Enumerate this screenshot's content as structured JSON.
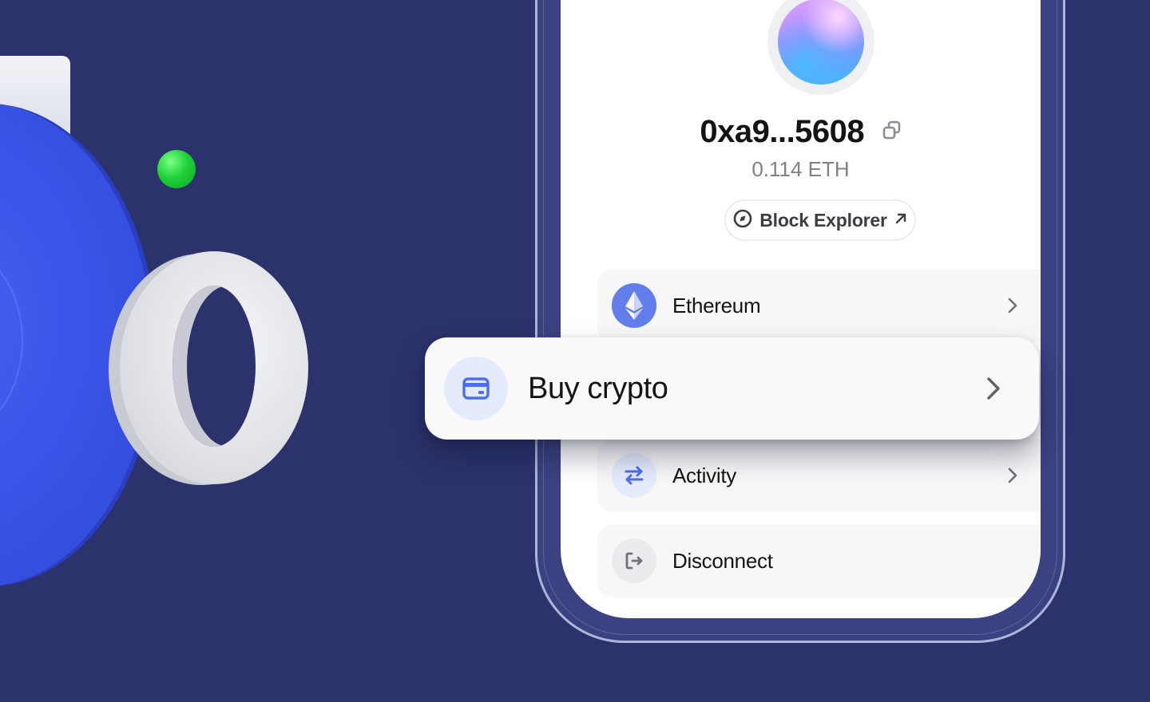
{
  "wallet": {
    "address": "0xa9...5608",
    "balance": "0.114 ETH",
    "copy_icon": "copy-icon",
    "avatar": "gradient-avatar"
  },
  "explorer": {
    "label": "Block Explorer",
    "icon": "compass-icon",
    "trailing_icon": "arrow-up-right-icon"
  },
  "menu": {
    "items": [
      {
        "label": "Ethereum",
        "icon": "ethereum-icon"
      },
      {
        "label": "Buy crypto",
        "icon": "card-icon"
      },
      {
        "label": "Activity",
        "icon": "swap-arrows-icon"
      },
      {
        "label": "Disconnect",
        "icon": "logout-icon"
      }
    ]
  },
  "colors": {
    "background": "#2c336c",
    "accent_blue": "#4d6ef2",
    "ethereum": "#627eea",
    "green_ball": "#1fd33a"
  }
}
